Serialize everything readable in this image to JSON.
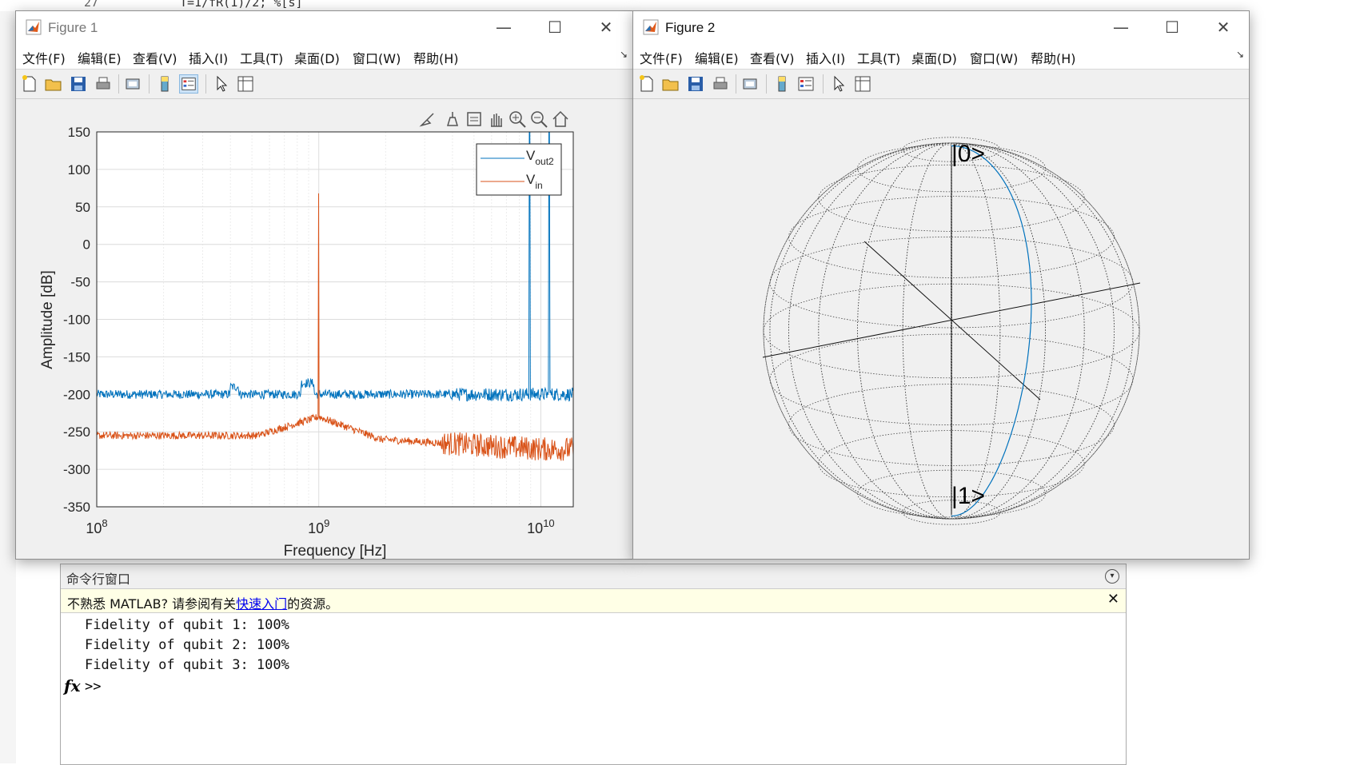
{
  "editor_bg": {
    "line_number": "27",
    "code": "T=1/fR(1)/2; %[s]"
  },
  "fig1": {
    "title": "Figure 1",
    "menus": [
      "文件(F)",
      "编辑(E)",
      "查看(V)",
      "插入(I)",
      "工具(T)",
      "桌面(D)",
      "窗口(W)",
      "帮助(H)"
    ],
    "chart_data": {
      "type": "line",
      "xlabel": "Frequency [Hz]",
      "ylabel": "Amplitude [dB]",
      "xscale": "log",
      "xlim": [
        100000000.0,
        14000000000.0
      ],
      "ylim": [
        -350,
        150
      ],
      "yticks": [
        "150",
        "100",
        "50",
        "0",
        "-50",
        "-100",
        "-150",
        "-200",
        "-250",
        "-300",
        "-350"
      ],
      "xticks": [
        {
          "base": "10",
          "exp": "8"
        },
        {
          "base": "10",
          "exp": "9"
        },
        {
          "base": "10",
          "exp": "10"
        }
      ],
      "grid": true,
      "legend_position": "top-right",
      "series": [
        {
          "name": "Vout2",
          "name_main": "V",
          "name_sub": "out2",
          "color": "#0072BD",
          "noise_floor": -200,
          "peaks": [
            {
              "x": 8900000000.0,
              "y": 150
            },
            {
              "x": 10900000000.0,
              "y": 150
            }
          ]
        },
        {
          "name": "Vin",
          "name_main": "V",
          "name_sub": "in",
          "color": "#D95319",
          "noise_floor": -255,
          "peaks": [
            {
              "x": 1000000000.0,
              "y": 68
            }
          ]
        }
      ]
    }
  },
  "fig2": {
    "title": "Figure 2",
    "menus": [
      "文件(F)",
      "编辑(E)",
      "查看(V)",
      "插入(I)",
      "工具(T)",
      "桌面(D)",
      "窗口(W)",
      "帮助(H)"
    ],
    "bloch": {
      "label_top": "|0>",
      "label_bottom": "|1>",
      "trajectory_color": "#0072BD"
    }
  },
  "command_window": {
    "title": "命令行窗口",
    "info_prefix": "不熟悉 MATLAB? 请参阅有关",
    "info_link": "快速入门",
    "info_suffix": "的资源。",
    "lines": [
      "Fidelity of qubit 1: 100%",
      "Fidelity of qubit 2: 100%",
      "Fidelity of qubit 3: 100%"
    ],
    "prompt": ">>"
  }
}
